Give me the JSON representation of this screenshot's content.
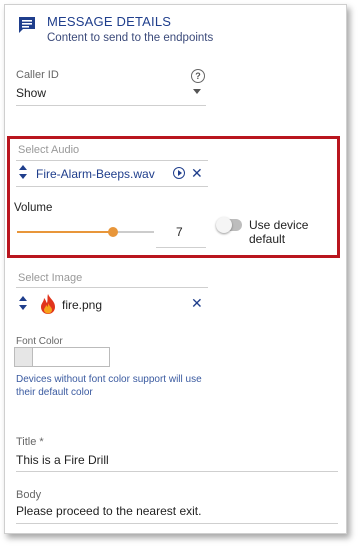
{
  "header": {
    "title": "MESSAGE DETAILS",
    "subtitle": "Content to send to the endpoints"
  },
  "caller_id": {
    "label": "Caller ID",
    "value": "Show"
  },
  "audio": {
    "label": "Select Audio",
    "file": "Fire-Alarm-Beeps.wav",
    "volume_label": "Volume",
    "volume_value": "7",
    "volume_fraction": 0.7,
    "toggle_label": "Use device default",
    "toggle_on": false
  },
  "image": {
    "label": "Select Image",
    "file": "fire.png"
  },
  "font_color": {
    "label": "Font Color",
    "note": "Devices without font color support will use their default color"
  },
  "title_field": {
    "label": "Title *",
    "value": "This is a Fire Drill"
  },
  "body_field": {
    "label": "Body",
    "value": "Please proceed to the nearest exit."
  },
  "colors": {
    "accent": "#1f3e8c",
    "highlight_border": "#b9151e",
    "slider": "#e8963a"
  }
}
